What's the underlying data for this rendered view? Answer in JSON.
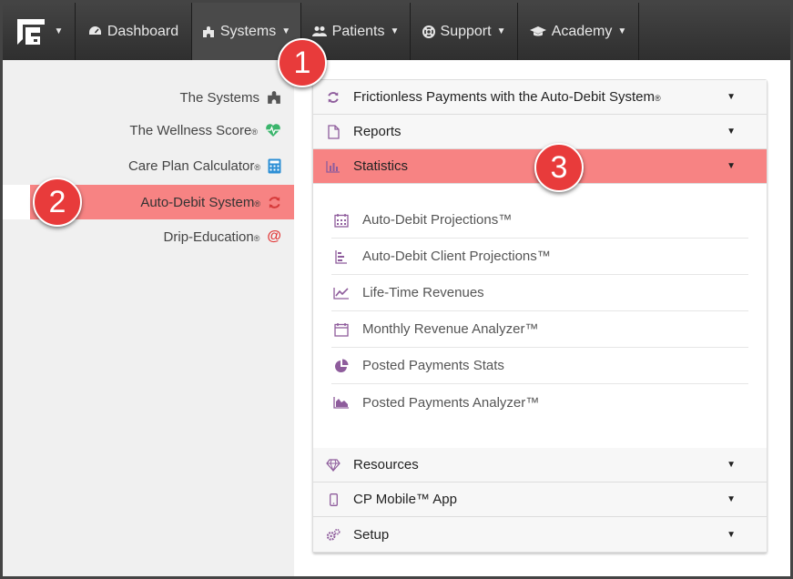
{
  "navbar": {
    "items": [
      {
        "label": "Dashboard",
        "icon": "dashboard-icon"
      },
      {
        "label": "Systems",
        "icon": "puzzle-icon"
      },
      {
        "label": "Patients",
        "icon": "users-icon"
      },
      {
        "label": "Support",
        "icon": "lifebuoy-icon"
      },
      {
        "label": "Academy",
        "icon": "graduation-cap-icon"
      }
    ]
  },
  "sidebar": {
    "items": [
      {
        "label": "The Systems",
        "reg": "",
        "icon": "puzzle-icon"
      },
      {
        "label": "The Wellness Score",
        "reg": "®",
        "icon": "heartbeat-icon"
      },
      {
        "label": "Care Plan Calculator",
        "reg": "®",
        "icon": "calculator-icon"
      },
      {
        "label": "Auto-Debit System",
        "reg": "®",
        "icon": "refresh-icon"
      },
      {
        "label": "Drip-Education",
        "reg": "®",
        "icon": "at-icon"
      }
    ]
  },
  "panel": {
    "headers": [
      {
        "label": "Frictionless Payments with the Auto-Debit System",
        "reg": "®",
        "icon": "refresh-icon"
      },
      {
        "label": "Reports",
        "reg": "",
        "icon": "document-icon"
      },
      {
        "label": "Statistics",
        "reg": "",
        "icon": "bar-chart-icon"
      },
      {
        "label": "Resources",
        "reg": "",
        "icon": "diamond-icon"
      },
      {
        "label": "CP Mobile™ App",
        "reg": "",
        "icon": "mobile-icon"
      },
      {
        "label": "Setup",
        "reg": "",
        "icon": "gears-icon"
      }
    ],
    "stats_items": [
      {
        "label": "Auto-Debit Projections™",
        "icon": "calendar-grid-icon"
      },
      {
        "label": "Auto-Debit Client Projections™",
        "icon": "bar-list-icon"
      },
      {
        "label": "Life-Time Revenues",
        "icon": "line-chart-icon"
      },
      {
        "label": "Monthly Revenue Analyzer™",
        "icon": "calendar-icon"
      },
      {
        "label": "Posted Payments Stats",
        "icon": "pie-chart-icon"
      },
      {
        "label": "Posted Payments Analyzer™",
        "icon": "area-chart-icon"
      }
    ]
  },
  "callouts": [
    "1",
    "2",
    "3"
  ],
  "colors": {
    "accent": "#f78383",
    "badge": "#e83b3b",
    "icon_purple": "#8e5c9c",
    "navbar": "#3a3a3a"
  }
}
